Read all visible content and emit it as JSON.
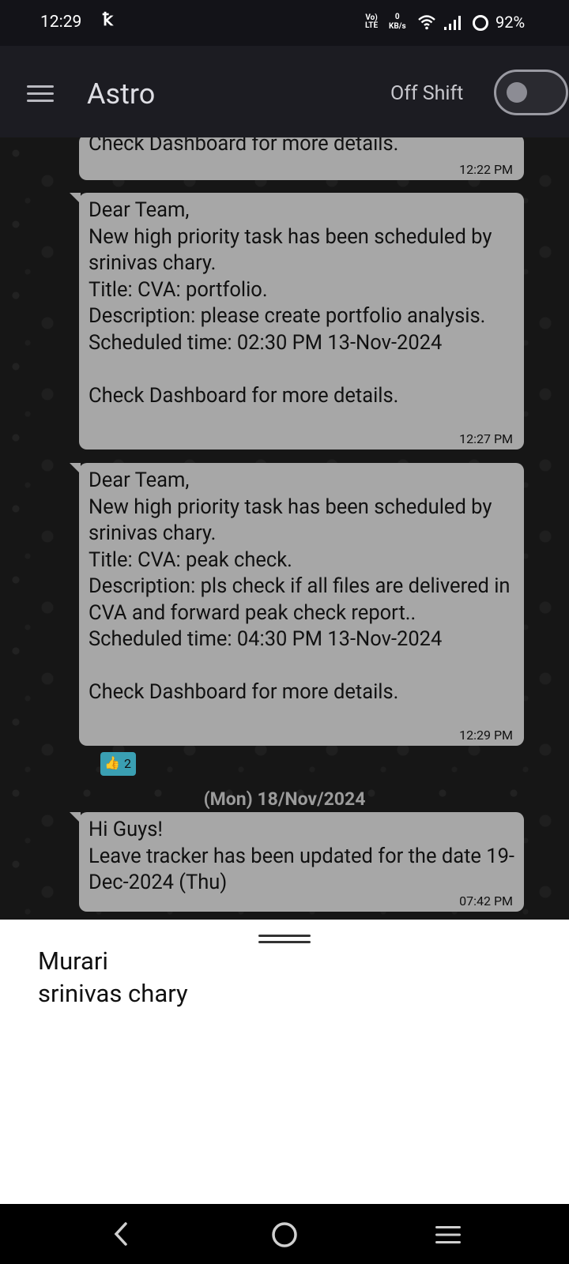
{
  "status_bar": {
    "time": "12:29",
    "indicator": "ꝁ",
    "volte_top": "Vo)",
    "volte_bottom": "LTE",
    "data_rate_value": "0",
    "data_rate_unit": "KB/s",
    "battery": "92%"
  },
  "app_bar": {
    "title": "Astro",
    "shift_label": "Off Shift",
    "shift_on": false
  },
  "messages": [
    {
      "text": "Check Dashboard for more details.",
      "time": "12:22 PM"
    },
    {
      "text": "Dear Team,\nNew high priority task has been scheduled by srinivas chary.\nTitle: CVA: portfolio.\nDescription: please create portfolio analysis.\nScheduled time: 02:30 PM 13-Nov-2024\n\nCheck Dashboard for more details.",
      "time": "12:27 PM"
    },
    {
      "text": "Dear Team,\nNew high priority task has been scheduled by srinivas chary.\nTitle: CVA: peak check.\nDescription: pls check if all files are delivered in CVA and forward peak check report..\nScheduled time: 04:30 PM 13-Nov-2024\n\nCheck Dashboard for more details.",
      "time": "12:29 PM"
    },
    {
      "text": "Hi Guys!\nLeave tracker has been updated for the date 19-Dec-2024 (Thu)",
      "time": "07:42 PM"
    }
  ],
  "reaction": {
    "emoji": "👍",
    "count": "2"
  },
  "date_separator": "(Mon) 18/Nov/2024",
  "bottom_sheet": {
    "items": [
      "Murari",
      "srinivas chary"
    ]
  },
  "nav_bar": {
    "back_icon": "back-chevron-icon",
    "home_icon": "home-circle-icon",
    "recents_icon": "menu-lines-icon"
  }
}
